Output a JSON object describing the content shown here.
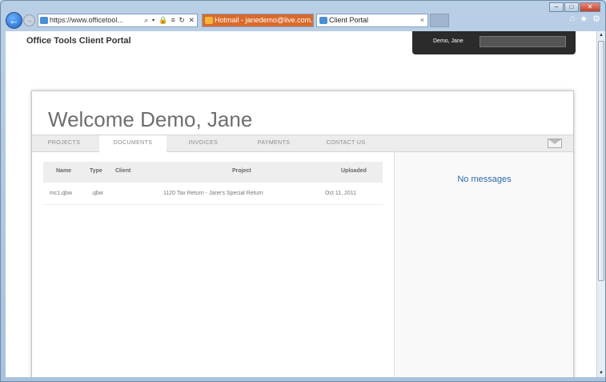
{
  "browser": {
    "address": "https://www.officetool...",
    "address_controls": "⌕ ▾ 🔒 ≡ ↻ ✕",
    "tabs": [
      {
        "label": "Hotmail - janedemo@live.com...",
        "active": false
      },
      {
        "label": "Client Portal",
        "active": true
      }
    ],
    "tab_close": "×",
    "back_glyph": "←",
    "forward_glyph": "→",
    "window_buttons": {
      "minimize": "–",
      "maximize": "□",
      "close": "✕"
    },
    "right_icons": [
      "home-icon",
      "star-icon",
      "gear-icon"
    ]
  },
  "portal": {
    "title": "Office Tools Client Portal",
    "user_name": "Demo, Jane",
    "welcome": "Welcome Demo, Jane"
  },
  "nav": {
    "items": [
      "PROJECTS",
      "DOCUMENTS",
      "INVOICES",
      "PAYMENTS",
      "CONTACT US"
    ],
    "active": "DOCUMENTS"
  },
  "documents": {
    "columns": [
      "Name",
      "Type",
      "Client",
      "Project",
      "Uploaded"
    ],
    "rows": [
      {
        "name": "mc1.qbw",
        "type": ".qbw",
        "client": "",
        "project": "1120 Tax Return - Jane's Special Return",
        "uploaded": "Oct 11, 2011"
      }
    ]
  },
  "messages": {
    "empty_text": "No messages"
  },
  "colors": {
    "accent_link": "#2a6aa8",
    "user_bar": "#2b2b2b",
    "nav_bg": "#ececec"
  }
}
